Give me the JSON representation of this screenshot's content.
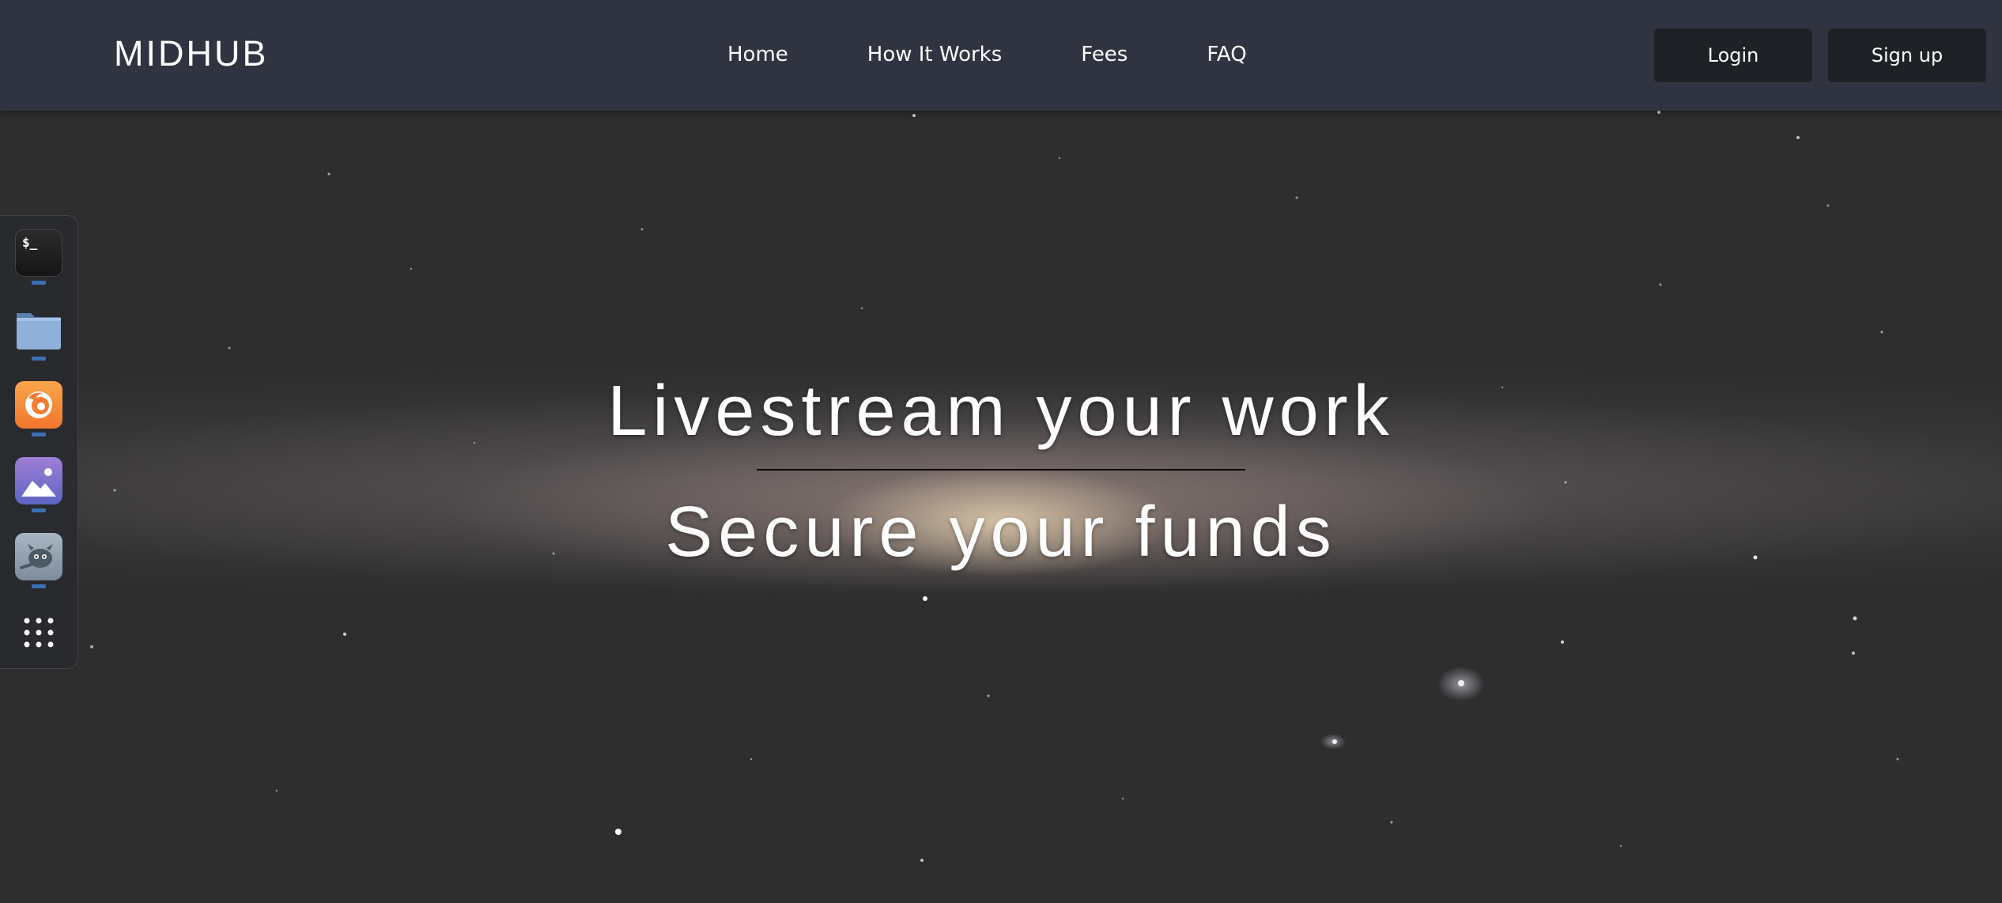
{
  "header": {
    "brand": "MIDHUB",
    "nav": [
      "Home",
      "How It Works",
      "Fees",
      "FAQ"
    ],
    "login_label": "Login",
    "signup_label": "Sign up"
  },
  "hero": {
    "line1": "Livestream your work",
    "line2": "Secure your funds"
  },
  "dock": {
    "apps": [
      {
        "name": "Terminal",
        "icon": "terminal-icon",
        "glyph": "$_",
        "running": true
      },
      {
        "name": "Files",
        "icon": "folder-icon",
        "running": true
      },
      {
        "name": "Firefox",
        "icon": "firefox-icon",
        "running": true
      },
      {
        "name": "Image Viewer",
        "icon": "image-viewer-icon",
        "running": true
      },
      {
        "name": "GIMP",
        "icon": "gimp-icon",
        "running": true
      },
      {
        "name": "Show Applications",
        "icon": "app-grid-icon",
        "running": false
      }
    ]
  },
  "colors": {
    "header_bg": "#2f3440",
    "button_bg": "#1e2126",
    "dock_bg": "#28292e",
    "dock_indicator": "#3d6fb4",
    "hero_text": "#ffffff",
    "sky": "#2e2e2f"
  }
}
